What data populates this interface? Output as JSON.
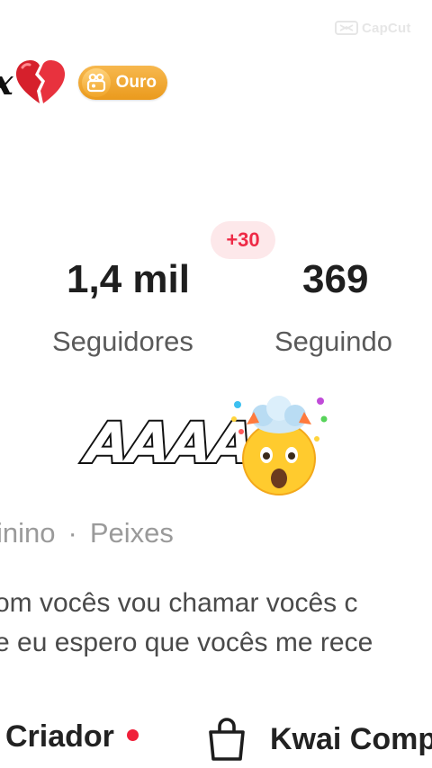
{
  "watermark": {
    "text": "CapCut",
    "icon": "capcut-logo-icon"
  },
  "profile": {
    "name_fragment": "x",
    "name_emoji_icon": "broken-heart-icon",
    "badge": {
      "label": "Ouro",
      "icon": "kwai-level-icon",
      "color": "#ef9f22"
    }
  },
  "stats": {
    "followers": {
      "value": "1,4 mil",
      "label": "Seguidores",
      "delta": "+30"
    },
    "following": {
      "value": "369",
      "label": "Seguindo"
    }
  },
  "sticker": {
    "text": "AAAA",
    "emoji_icon": "exploding-head-icon"
  },
  "details": {
    "gender": "inino",
    "separator": "·",
    "sign": "Peixes"
  },
  "bio": {
    "line1": "om vocês vou chamar vocês c",
    "line2": "e eu espero que vocês me rece"
  },
  "links": {
    "creator_label": "Criador",
    "creator_dot_color": "#f0203a",
    "shop_label": "Kwai Comp",
    "shop_icon": "shopping-bag-icon"
  },
  "colors": {
    "accent_red": "#ee2a46",
    "badge_gold": "#ef9f22"
  }
}
